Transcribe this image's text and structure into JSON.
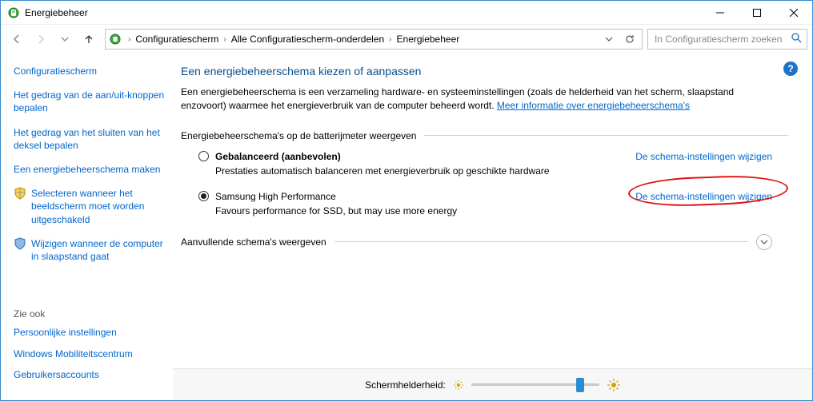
{
  "window": {
    "title": "Energiebeheer"
  },
  "breadcrumb": {
    "items": [
      "Configuratiescherm",
      "Alle Configuratiescherm-onderdelen",
      "Energiebeheer"
    ]
  },
  "search": {
    "placeholder": "In Configuratiescherm zoeken"
  },
  "sidebar": {
    "header": "Configuratiescherm",
    "links": [
      "Het gedrag van de aan/uit-knoppen bepalen",
      "Het gedrag van het sluiten van het deksel bepalen",
      "Een energiebeheerschema maken",
      "Selecteren wanneer het beeldscherm moet worden uitgeschakeld",
      "Wijzigen wanneer de computer in slaapstand gaat"
    ],
    "see_also_title": "Zie ook",
    "see_also": [
      "Persoonlijke instellingen",
      "Windows Mobiliteitscentrum",
      "Gebruikersaccounts"
    ]
  },
  "main": {
    "title": "Een energiebeheerschema kiezen of aanpassen",
    "intro_a": "Een energiebeheerschema is een verzameling hardware- en systeeminstellingen (zoals de helderheid van het scherm, slaapstand enzovoort) waarmee het energieverbruik van de computer beheerd wordt. ",
    "intro_link": "Meer informatie over energiebeheerschema's",
    "group_label": "Energiebeheerschema's op de batterijmeter weergeven",
    "plans": [
      {
        "name": "Gebalanceerd (aanbevolen)",
        "desc": "Prestaties automatisch balanceren met energieverbruik op geschikte hardware",
        "change": "De schema-instellingen wijzigen",
        "selected": false,
        "bold": true
      },
      {
        "name": "Samsung High Performance",
        "desc": "Favours performance for SSD, but may use more energy",
        "change": "De schema-instellingen wijzigen",
        "selected": true,
        "bold": false
      }
    ],
    "expand_label": "Aanvullende schema's weergeven"
  },
  "brightness": {
    "label": "Schermhelderheid:",
    "value_percent": 82
  },
  "help": {
    "label": "?"
  },
  "colors": {
    "link": "#0066cc",
    "heading": "#0a4e8c"
  }
}
